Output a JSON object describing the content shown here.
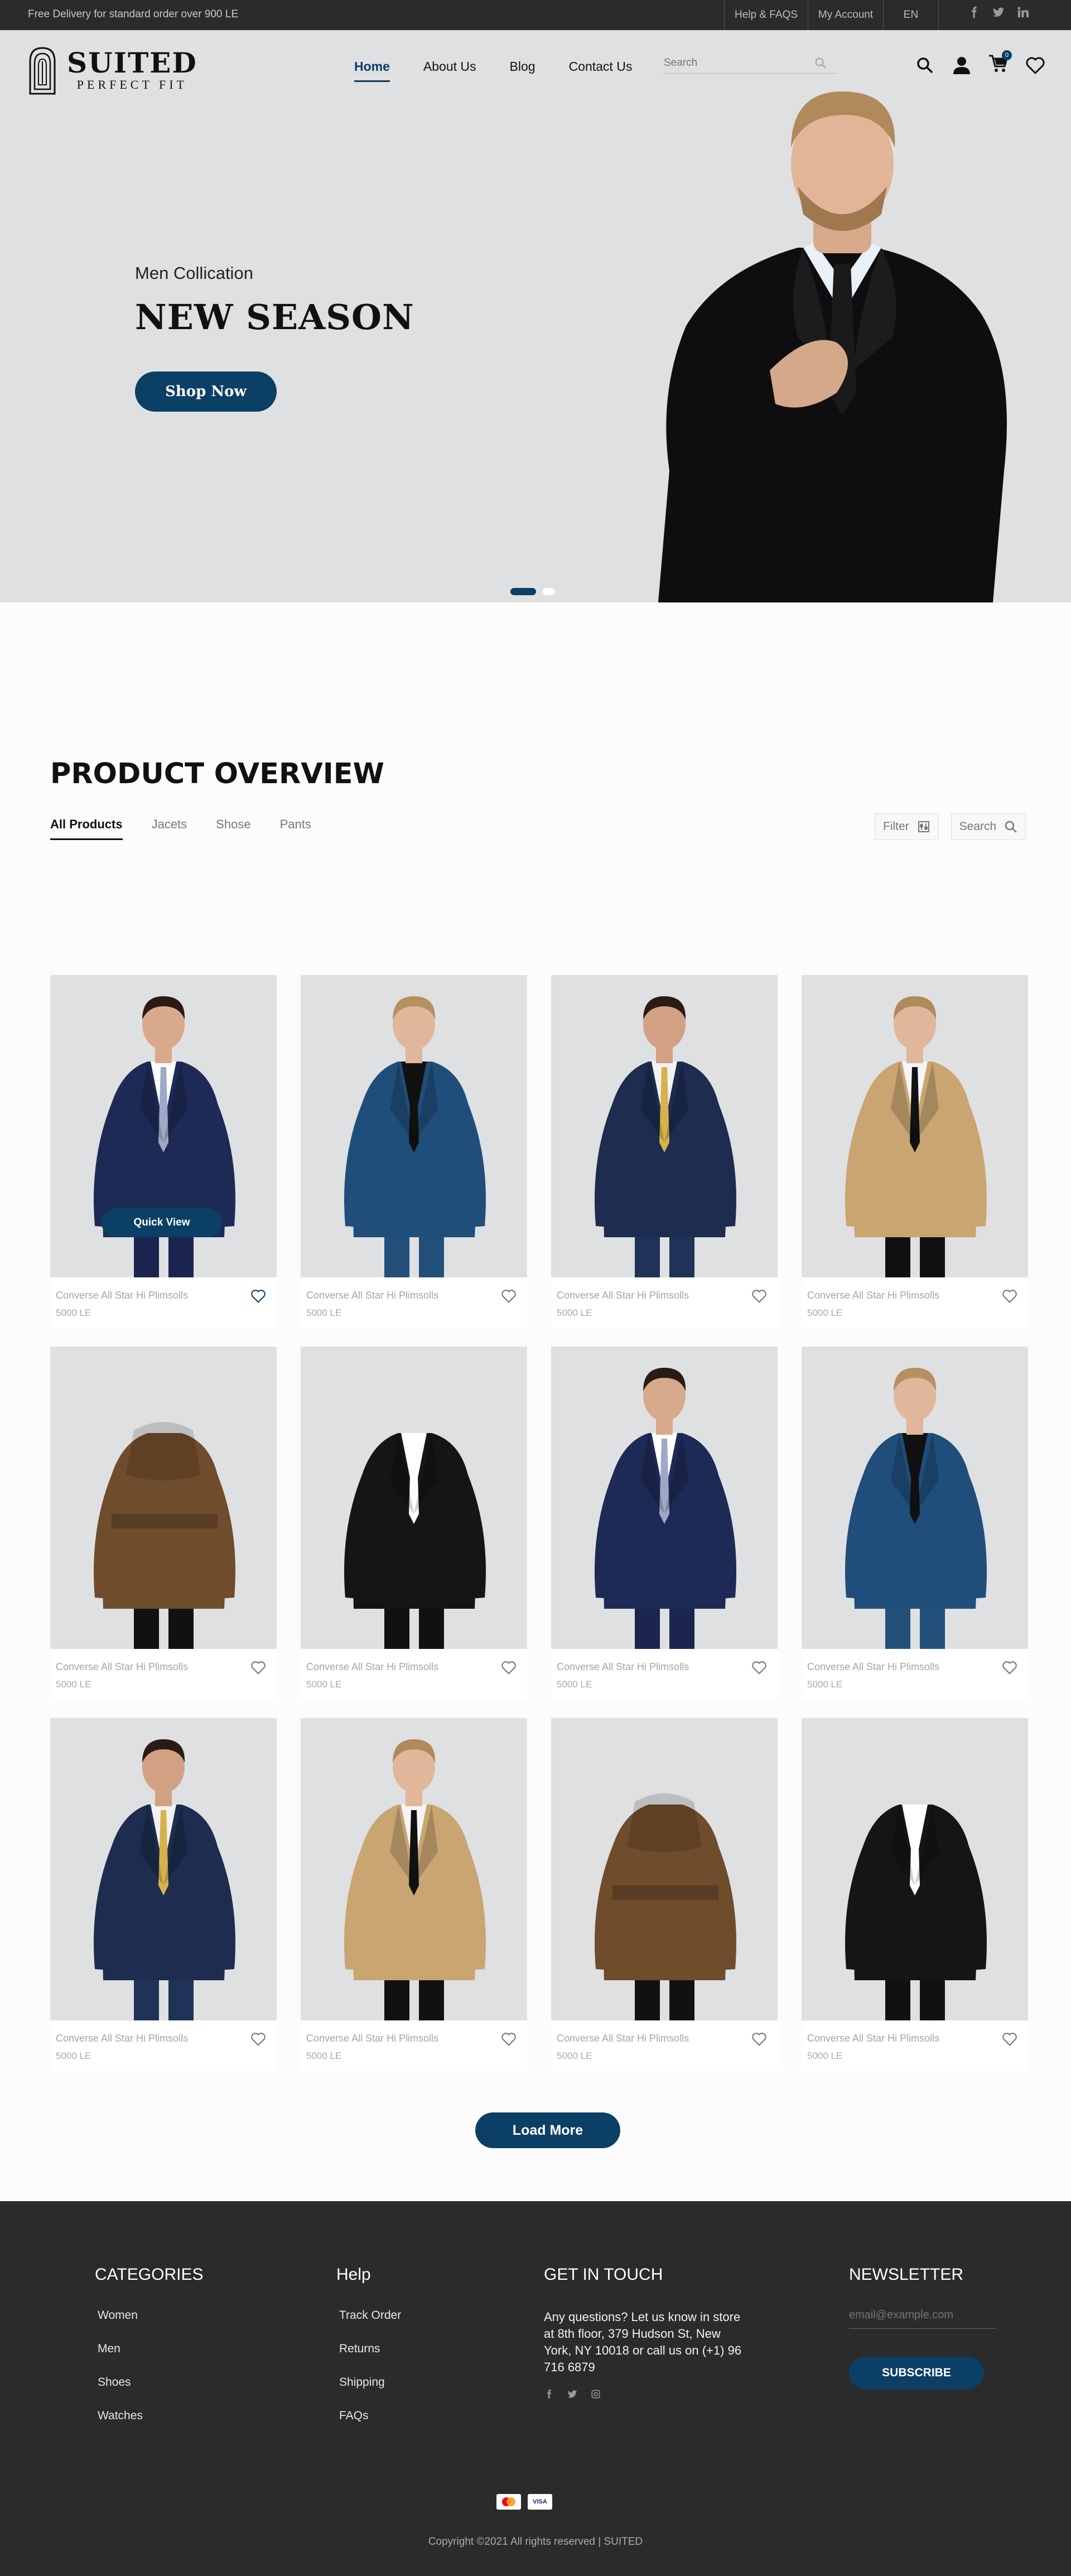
{
  "topbar": {
    "promo": "Free Delivery for standard order over 900 LE",
    "help": "Help & FAQS",
    "account": "My Account",
    "language": "EN",
    "social": [
      "facebook-icon",
      "twitter-icon",
      "linkedin-icon"
    ]
  },
  "brand": {
    "name": "SUITED",
    "tagline": "PERFECT FIT"
  },
  "nav": {
    "items": [
      {
        "label": "Home",
        "active": true
      },
      {
        "label": "About Us",
        "active": false
      },
      {
        "label": "Blog",
        "active": false
      },
      {
        "label": "Contact Us",
        "active": false
      }
    ],
    "search_placeholder": "Search",
    "icons": [
      "search-icon",
      "user-icon",
      "cart-icon",
      "heart-icon"
    ],
    "cart_badge": "0"
  },
  "hero": {
    "subtitle": "Men Collication",
    "title": "NEW SEASON",
    "cta": "Shop Now",
    "slides": 2,
    "active_slide": 1
  },
  "overview": {
    "title": "PRODUCT OVERVIEW",
    "tabs": [
      "All Products",
      "Jacets",
      "Shose",
      "Pants"
    ],
    "active_tab": "All Products",
    "filter_label": "Filter",
    "search_label": "Search",
    "quick_view": "Quick View",
    "products": [
      {
        "name": "Converse All Star Hi Plimsolls",
        "price": "5000 LE",
        "style": "navy-suit",
        "favorited": true
      },
      {
        "name": "Converse All Star Hi Plimsolls",
        "price": "5000 LE",
        "style": "blue-blazer",
        "favorited": false
      },
      {
        "name": "Converse All Star Hi Plimsolls",
        "price": "5000 LE",
        "style": "navy-three-piece",
        "favorited": false
      },
      {
        "name": "Converse All Star Hi Plimsolls",
        "price": "5000 LE",
        "style": "beige-trench",
        "favorited": false
      },
      {
        "name": "Converse All Star Hi Plimsolls",
        "price": "5000 LE",
        "style": "brown-trench-back",
        "favorited": false
      },
      {
        "name": "Converse All Star Hi Plimsolls",
        "price": "5000 LE",
        "style": "black-coat",
        "favorited": false
      },
      {
        "name": "Converse All Star Hi Plimsolls",
        "price": "5000 LE",
        "style": "navy-suit",
        "favorited": false
      },
      {
        "name": "Converse All Star Hi Plimsolls",
        "price": "5000 LE",
        "style": "blue-blazer",
        "favorited": false
      },
      {
        "name": "Converse All Star Hi Plimsolls",
        "price": "5000 LE",
        "style": "navy-three-piece",
        "favorited": false
      },
      {
        "name": "Converse All Star Hi Plimsolls",
        "price": "5000 LE",
        "style": "beige-trench",
        "favorited": false
      },
      {
        "name": "Converse All Star Hi Plimsolls",
        "price": "5000 LE",
        "style": "brown-trench-back",
        "favorited": false
      },
      {
        "name": "Converse All Star Hi Plimsolls",
        "price": "5000 LE",
        "style": "black-coat",
        "favorited": false
      }
    ],
    "load_more": "Load More"
  },
  "footer": {
    "categories": {
      "title": "CATEGORIES",
      "items": [
        "Women",
        "Men",
        "Shoes",
        "Watches"
      ]
    },
    "help": {
      "title": "Help",
      "items": [
        "Track Order",
        "Returns",
        "Shipping",
        "FAQs"
      ]
    },
    "contact": {
      "title": "GET IN TOUCH",
      "text": "Any questions? Let us know in store at 8th floor, 379 Hudson St, New York, NY 10018 or call us on (+1) 96 716 6879",
      "social": [
        "facebook-icon",
        "twitter-icon",
        "instagram-icon"
      ]
    },
    "newsletter": {
      "title": "NEWSLETTER",
      "placeholder": "email@example.com",
      "button": "SUBSCRIBE"
    },
    "payments": [
      "mastercard-icon",
      "visa-icon"
    ],
    "visa_label": "VISA",
    "copyright": "Copyright ©2021 All rights reserved | SUITED"
  },
  "colors": {
    "primary": "#0b3f66",
    "topbar": "#2b2b2c",
    "hero_bg": "#dfe0e2",
    "footer": "#2b2b2c"
  }
}
